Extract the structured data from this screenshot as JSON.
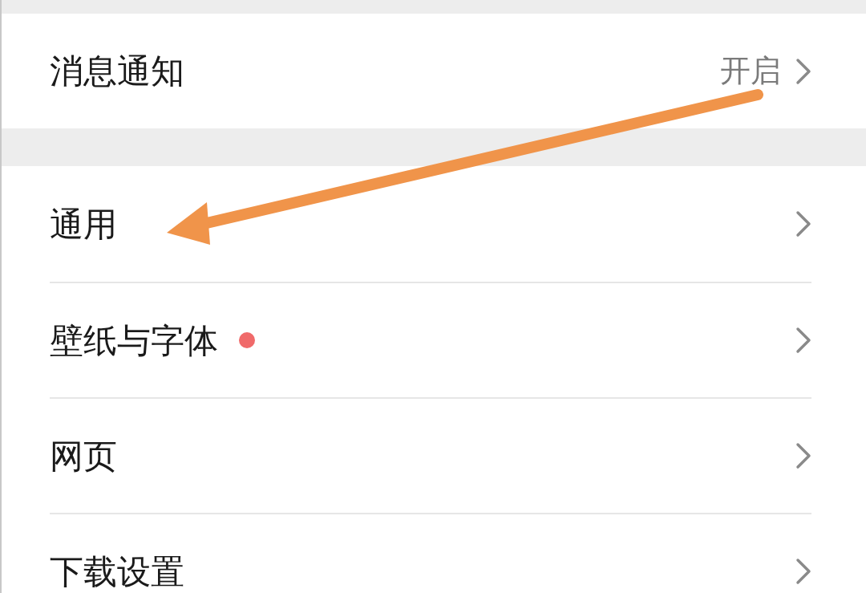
{
  "sections": [
    {
      "items": [
        {
          "label": "消息通知",
          "value": "开启",
          "dot": false
        }
      ]
    },
    {
      "items": [
        {
          "label": "通用",
          "dot": false
        },
        {
          "label": "壁纸与字体",
          "dot": true
        },
        {
          "label": "网页",
          "dot": false
        },
        {
          "label": "下载设置",
          "dot": false
        }
      ]
    }
  ]
}
